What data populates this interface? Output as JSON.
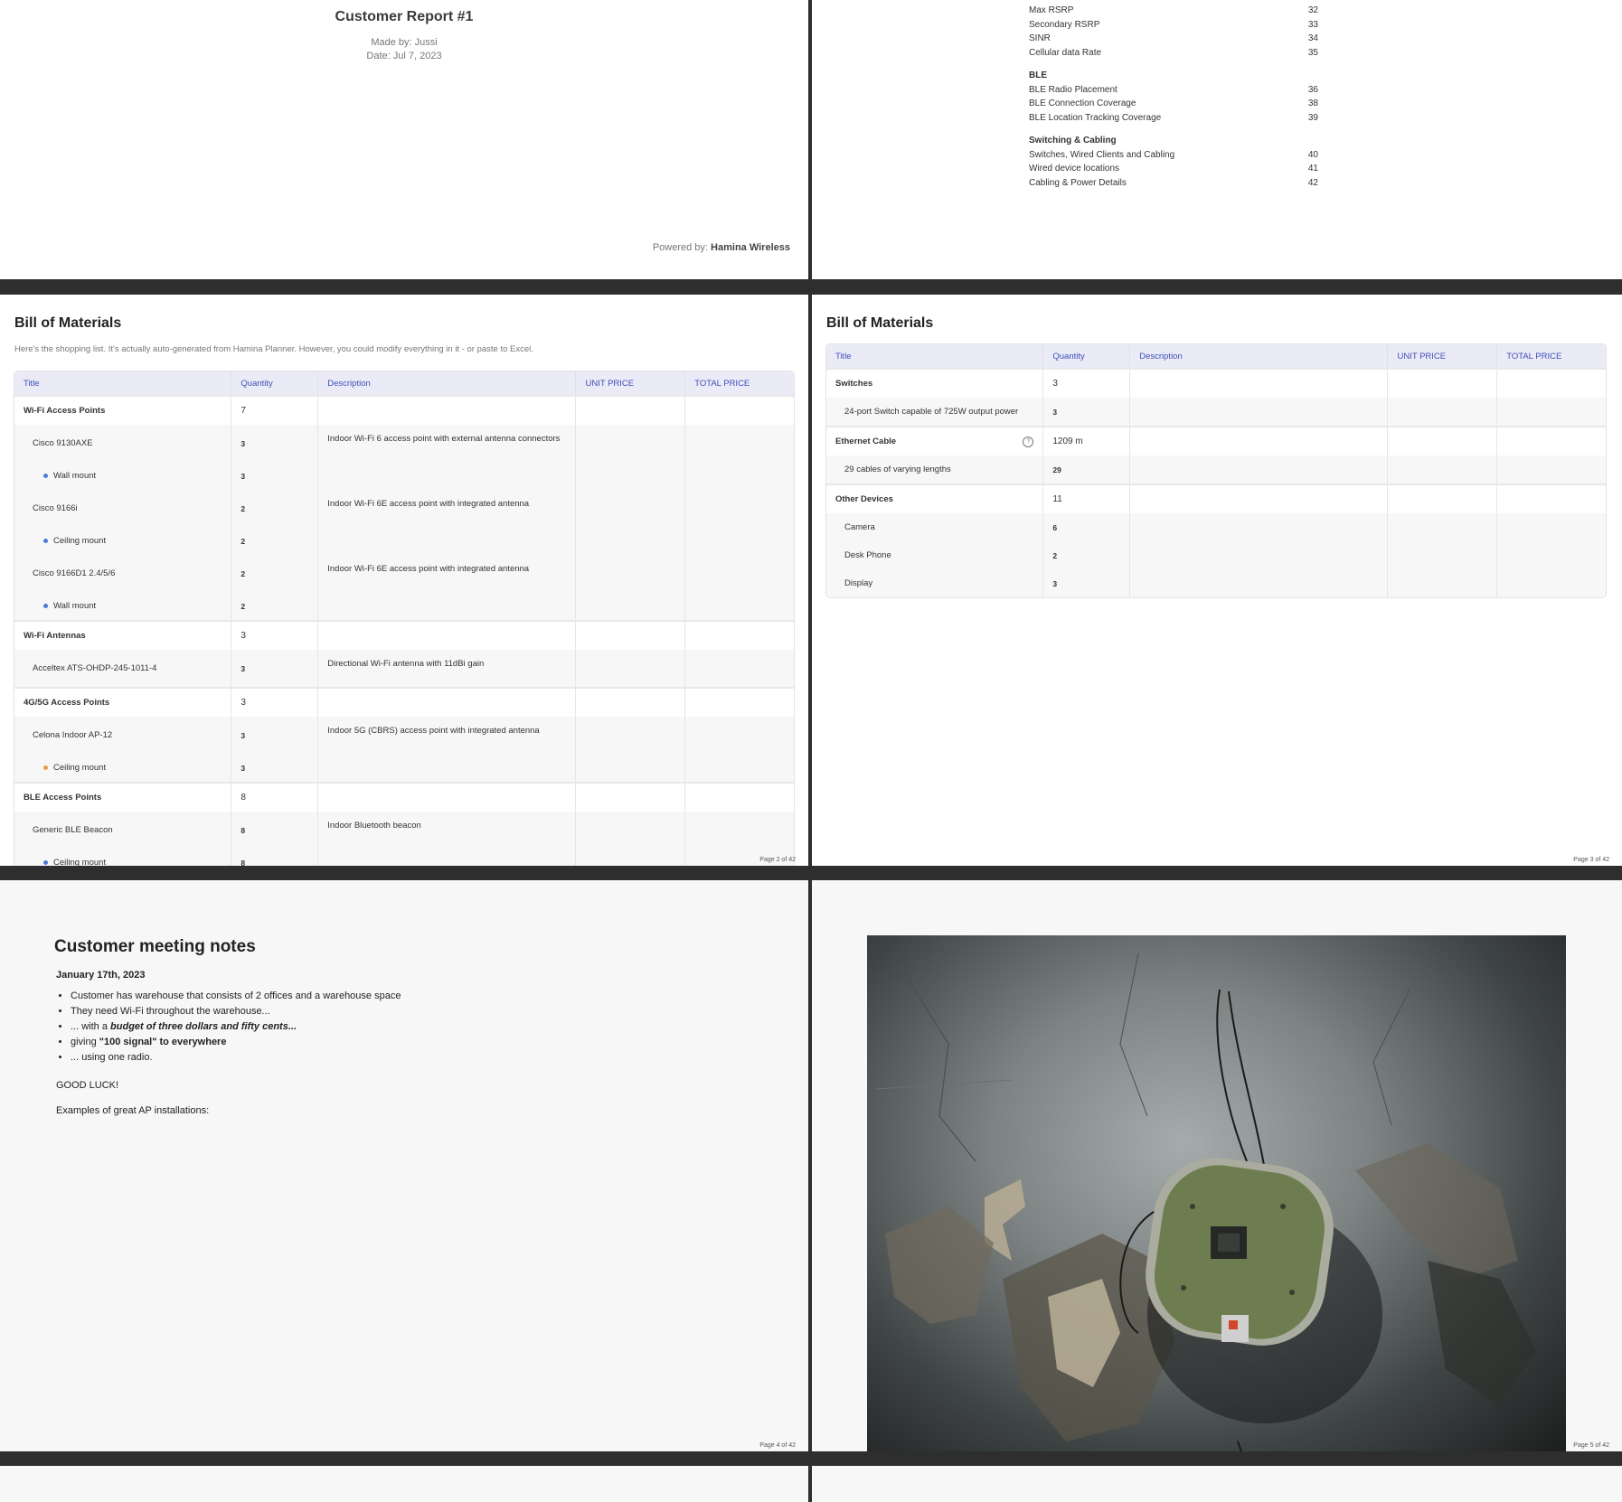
{
  "cover": {
    "title": "Customer Report #1",
    "made_by": "Made by: Jussi",
    "date": "Date: Jul 7, 2023",
    "powered_label": "Powered by:",
    "powered_brand": "Hamina Wireless"
  },
  "toc": {
    "rows_a": [
      {
        "label": "Max RSRP",
        "page": "32"
      },
      {
        "label": "Secondary RSRP",
        "page": "33"
      },
      {
        "label": "SINR",
        "page": "34"
      },
      {
        "label": "Cellular data Rate",
        "page": "35"
      }
    ],
    "sec_ble": "BLE",
    "rows_b": [
      {
        "label": "BLE Radio Placement",
        "page": "36"
      },
      {
        "label": "BLE Connection Coverage",
        "page": "38"
      },
      {
        "label": "BLE Location Tracking Coverage",
        "page": "39"
      }
    ],
    "sec_switch": "Switching & Cabling",
    "rows_c": [
      {
        "label": "Switches, Wired Clients and Cabling",
        "page": "40"
      },
      {
        "label": "Wired device locations",
        "page": "41"
      },
      {
        "label": "Cabling & Power Details",
        "page": "42"
      }
    ]
  },
  "bom": {
    "title": "Bill of Materials",
    "description": "Here's the shopping list. It's actually auto-generated from Hamina Planner. However, you could modify everything in it - or paste to Excel.",
    "headers": {
      "title": "Title",
      "quantity": "Quantity",
      "description": "Description",
      "unit_price": "UNIT PRICE",
      "total_price": "TOTAL PRICE"
    },
    "rows1": [
      {
        "type": "cat",
        "title": "Wi-Fi Access Points",
        "qty": "7",
        "desc": ""
      },
      {
        "type": "item",
        "title": "Cisco 9130AXE",
        "qty": "3",
        "desc": "Indoor Wi-Fi 6 access point with external antenna connectors"
      },
      {
        "type": "sub",
        "title": "Wall mount",
        "qty": "3",
        "desc": "",
        "dot": "blue"
      },
      {
        "type": "item",
        "title": "Cisco 9166i",
        "qty": "2",
        "desc": "Indoor Wi-Fi 6E access point with integrated antenna"
      },
      {
        "type": "sub",
        "title": "Ceiling mount",
        "qty": "2",
        "desc": "",
        "dot": "blue"
      },
      {
        "type": "item",
        "title": "Cisco 9166D1 2.4/5/6",
        "qty": "2",
        "desc": "Indoor Wi-Fi 6E access point with integrated antenna"
      },
      {
        "type": "sub",
        "title": "Wall mount",
        "qty": "2",
        "desc": "",
        "dot": "blue"
      },
      {
        "type": "cat",
        "title": "Wi-Fi Antennas",
        "qty": "3",
        "desc": ""
      },
      {
        "type": "item",
        "title": "Acceltex ATS-OHDP-245-1011-4",
        "qty": "3",
        "desc": "Directional Wi-Fi antenna with 11dBi gain"
      },
      {
        "type": "cat",
        "title": "4G/5G Access Points",
        "qty": "3",
        "desc": ""
      },
      {
        "type": "item",
        "title": "Celona Indoor AP-12",
        "qty": "3",
        "desc": "Indoor 5G (CBRS) access point with integrated antenna"
      },
      {
        "type": "sub",
        "title": "Ceiling mount",
        "qty": "3",
        "desc": "",
        "dot": "orange"
      },
      {
        "type": "cat",
        "title": "BLE Access Points",
        "qty": "8",
        "desc": ""
      },
      {
        "type": "item",
        "title": "Generic BLE Beacon",
        "qty": "8",
        "desc": "Indoor Bluetooth beacon"
      },
      {
        "type": "sub",
        "title": "Ceiling mount",
        "qty": "8",
        "desc": "",
        "dot": "blue"
      }
    ],
    "rows2": [
      {
        "type": "cat",
        "title": "Switches",
        "qty": "3",
        "desc": ""
      },
      {
        "type": "item",
        "title": "24-port Switch capable of 725W output power",
        "qty": "3",
        "desc": ""
      },
      {
        "type": "cat",
        "title": "Ethernet Cable",
        "qty": "1209 m",
        "desc": "",
        "help": "?"
      },
      {
        "type": "item",
        "title": "29 cables of varying lengths",
        "qty": "29",
        "desc": ""
      },
      {
        "type": "cat",
        "title": "Other Devices",
        "qty": "11",
        "desc": ""
      },
      {
        "type": "item",
        "title": "Camera",
        "qty": "6",
        "desc": ""
      },
      {
        "type": "item",
        "title": "Desk Phone",
        "qty": "2",
        "desc": ""
      },
      {
        "type": "item",
        "title": "Display",
        "qty": "3",
        "desc": ""
      }
    ],
    "page2": "Page 2 of 42",
    "page3": "Page 3 of 42"
  },
  "notes": {
    "title": "Customer meeting notes",
    "date": "January 17th, 2023",
    "b1": "Customer has warehouse that consists of 2 offices and a warehouse space",
    "b2": "They need Wi-Fi throughout the warehouse...",
    "b3_pre": "... with a ",
    "b3_em": "budget of three dollars and fifty cents...",
    "b4_pre": "giving ",
    "b4_strong": "\"100 signal\" to everywhere",
    "b5": "... using one radio.",
    "luck": "GOOD LUCK!",
    "examples": "Examples of great AP installations:",
    "page4": "Page 4 of 42"
  },
  "photo": {
    "page5": "Page 5 of 42",
    "colors": {
      "wall": "#8a8f8f",
      "device": "#6b7a4e",
      "shadow": "#1c1e1e"
    }
  }
}
